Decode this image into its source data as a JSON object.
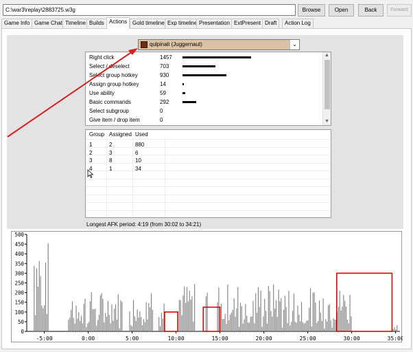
{
  "toolbar": {
    "path": "C:\\war3\\replay\\2883725.w3g",
    "browse_label": "Browse",
    "open_label": "Open",
    "back_label": "Back",
    "forward_label": "Forward"
  },
  "tabs": [
    {
      "label": "Game Info"
    },
    {
      "label": "Game Chat"
    },
    {
      "label": "Timeline"
    },
    {
      "label": "Builds"
    },
    {
      "label": "Actions",
      "active": true
    },
    {
      "label": "Gold timeline"
    },
    {
      "label": "Exp timeline"
    },
    {
      "label": "Presentation"
    },
    {
      "label": "ExtPresent"
    },
    {
      "label": "Draft"
    },
    {
      "label": "Action Log"
    }
  ],
  "player_select": {
    "value": "qulpinali (Juggernaut)",
    "icon": "hero-portrait-icon"
  },
  "actions": [
    {
      "name": "Right click",
      "count": 1457
    },
    {
      "name": "Select / deselect",
      "count": 703
    },
    {
      "name": "Select group hotkey",
      "count": 930
    },
    {
      "name": "Assign group hotkey",
      "count": 14
    },
    {
      "name": "Use ability",
      "count": 59
    },
    {
      "name": "Basic commands",
      "count": 292
    },
    {
      "name": "Select subgroup",
      "count": 0
    },
    {
      "name": "Give item / drop item",
      "count": 0
    }
  ],
  "groups": {
    "headers": [
      "Group",
      "Assigned",
      "Used"
    ],
    "rows": [
      [
        "1",
        "2",
        "880"
      ],
      [
        "2",
        "3",
        "6"
      ],
      [
        "3",
        "8",
        "10"
      ],
      [
        "4",
        "1",
        "34"
      ]
    ]
  },
  "afk_text": "Longest AFK period: 4:19 (from 30:02 to 34:21)",
  "chart_data": {
    "type": "bar",
    "title": "",
    "xlabel": "",
    "ylabel": "",
    "x_ticks": [
      "-5:00",
      "0:00",
      "5:00",
      "10:00",
      "15:00",
      "20:00",
      "25:00",
      "30:00",
      "35:00"
    ],
    "y_ticks": [
      "0",
      "50",
      "100",
      "150",
      "200",
      "250",
      "300",
      "350",
      "400",
      "450",
      "500"
    ],
    "xlim": [
      -7,
      35.5
    ],
    "ylim": [
      0,
      500
    ],
    "highlights": [
      {
        "x_range": [
          8.7,
          10.2
        ],
        "y_range": [
          0,
          100
        ]
      },
      {
        "x_range": [
          13.1,
          15.0
        ],
        "y_range": [
          0,
          125
        ]
      },
      {
        "x_range": [
          28.3,
          34.6
        ],
        "y_range": [
          0,
          300
        ]
      }
    ],
    "bar_color": "#7f7f7f",
    "highlight_color": "#e00000"
  },
  "annotation": {
    "arrow_color": "#d42020",
    "cursor_icon": "mouse-cursor-icon"
  }
}
